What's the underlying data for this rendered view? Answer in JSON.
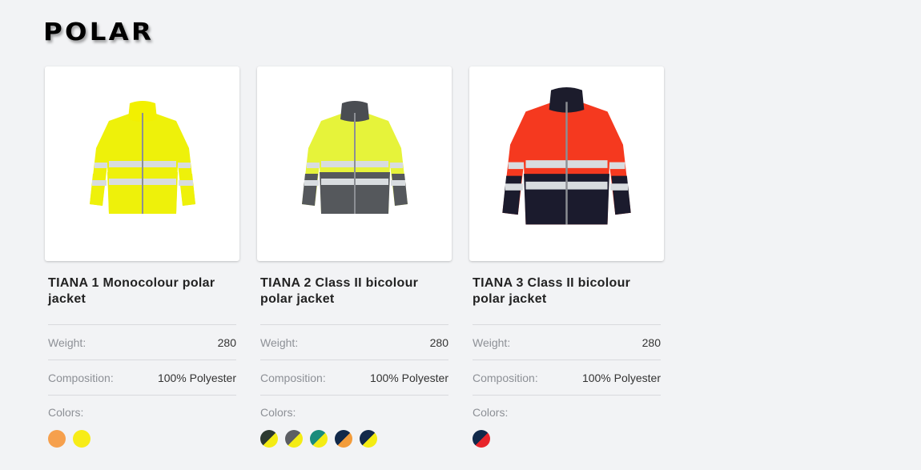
{
  "brand": {
    "name": "POLAR"
  },
  "products": [
    {
      "title": "TIANA 1 Monocolour polar jacket",
      "image_icon": "yellow-hi-vis-jacket",
      "jacket": {
        "collar": "#f2f000",
        "body_top": "#eef10a",
        "body_bottom": "#eef10a",
        "sleeve_bottom": "#eef10a"
      },
      "weight_label": "Weight:",
      "weight_value": "280",
      "composition_label": "Composition:",
      "composition_value": "100% Polyester",
      "colors_label": "Colors:",
      "colors": [
        {
          "name": "orange",
          "a": "#f6a04d",
          "b": "#f6a04d"
        },
        {
          "name": "yellow",
          "a": "#f7ec18",
          "b": "#f7ec18"
        }
      ]
    },
    {
      "title": "TIANA 2 Class II bicolour polar jacket",
      "image_icon": "yellow-grey-hi-vis-jacket",
      "jacket": {
        "collar": "#4a4d52",
        "body_top": "#e6f33a",
        "body_bottom": "#55585c",
        "sleeve_bottom": "#55585c"
      },
      "weight_label": "Weight:",
      "weight_value": "280",
      "composition_label": "Composition:",
      "composition_value": "100% Polyester",
      "colors_label": "Colors:",
      "colors": [
        {
          "name": "dark-green-yellow",
          "a": "#2d3a30",
          "b": "#f4ec14"
        },
        {
          "name": "grey-yellow",
          "a": "#5c5e63",
          "b": "#f4ec14"
        },
        {
          "name": "teal-yellow",
          "a": "#1a8c7c",
          "b": "#f4ec14"
        },
        {
          "name": "navy-orange",
          "a": "#12294a",
          "b": "#f39c3a"
        },
        {
          "name": "navy-yellow",
          "a": "#12294a",
          "b": "#f4ec14"
        }
      ]
    },
    {
      "title": "TIANA 3 Class II bicolour polar jacket",
      "image_icon": "red-navy-hi-vis-jacket",
      "jacket": {
        "collar": "#1c1c2c",
        "body_top": "#f5391f",
        "body_bottom": "#1b1b2d",
        "sleeve_bottom": "#1b1b2d"
      },
      "weight_label": "Weight:",
      "weight_value": "280",
      "composition_label": "Composition:",
      "composition_value": "100% Polyester",
      "colors_label": "Colors:",
      "colors": [
        {
          "name": "navy-red",
          "a": "#12294a",
          "b": "#e8242b"
        }
      ]
    }
  ]
}
